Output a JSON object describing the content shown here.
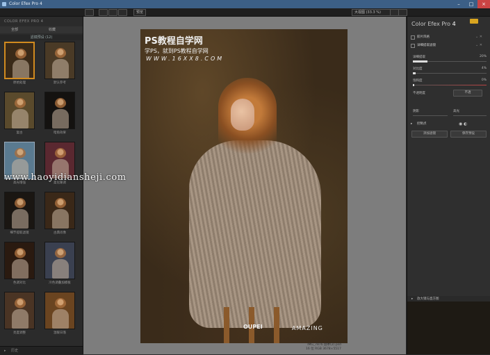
{
  "window": {
    "title": "Color Efex Pro 4"
  },
  "toolbar": {
    "preview_button": "预览",
    "zoom_select": "大视图 (33.3 %)"
  },
  "left_panel": {
    "breadcrumb": "COLOR EFEX PRO 4",
    "tab_all": "全部",
    "tab_fav": "收藏",
    "section": "滤镜预设 (12)",
    "thumbs": [
      {
        "label": "原始处理"
      },
      {
        "label": "默认参考"
      },
      {
        "label": "复古"
      },
      {
        "label": "暗角效果"
      },
      {
        "label": "高光增强"
      },
      {
        "label": "柔化暖调"
      },
      {
        "label": "细节提取滤镜"
      },
      {
        "label": "古典肖像"
      },
      {
        "label": "色调对比"
      },
      {
        "label": "冷色调叠加模板"
      },
      {
        "label": "亮度调整"
      },
      {
        "label": "温暖日落"
      }
    ],
    "bottom_label": "历史"
  },
  "canvas": {
    "watermark_title": "PS教程自学网",
    "watermark_sub": "学PS，就到PS教程自学网",
    "watermark_url": "WWW.16XX8.COM",
    "overlay_url": "www.haoyidiansheji.com",
    "logo1": "OUPEI",
    "logo2": "AMAZING",
    "file_info_1": "IMG_7876 副本(2).psd",
    "file_info_2": "16 位 RGB  3678×5517"
  },
  "right_panel": {
    "brand": "Color Efex Pro",
    "brand_ver": "4",
    "fx1": "胶片风格",
    "fx2": "详细提取滤镜",
    "params": [
      {
        "label": "详细提取",
        "value": "20%",
        "fill": 0.2
      },
      {
        "label": "对比度",
        "value": "4%",
        "fill": 0.04
      },
      {
        "label": "饱和度",
        "value": "0%",
        "fill": 0.0
      }
    ],
    "blend_label": "不透明度",
    "blend_value": "不透",
    "shadow_label": "阴影",
    "highlight_label": "高光",
    "control_points": "控制点",
    "add_filter": "添加滤镜",
    "save_preset": "保存预设",
    "lower_label": "放大镜与直方图"
  }
}
